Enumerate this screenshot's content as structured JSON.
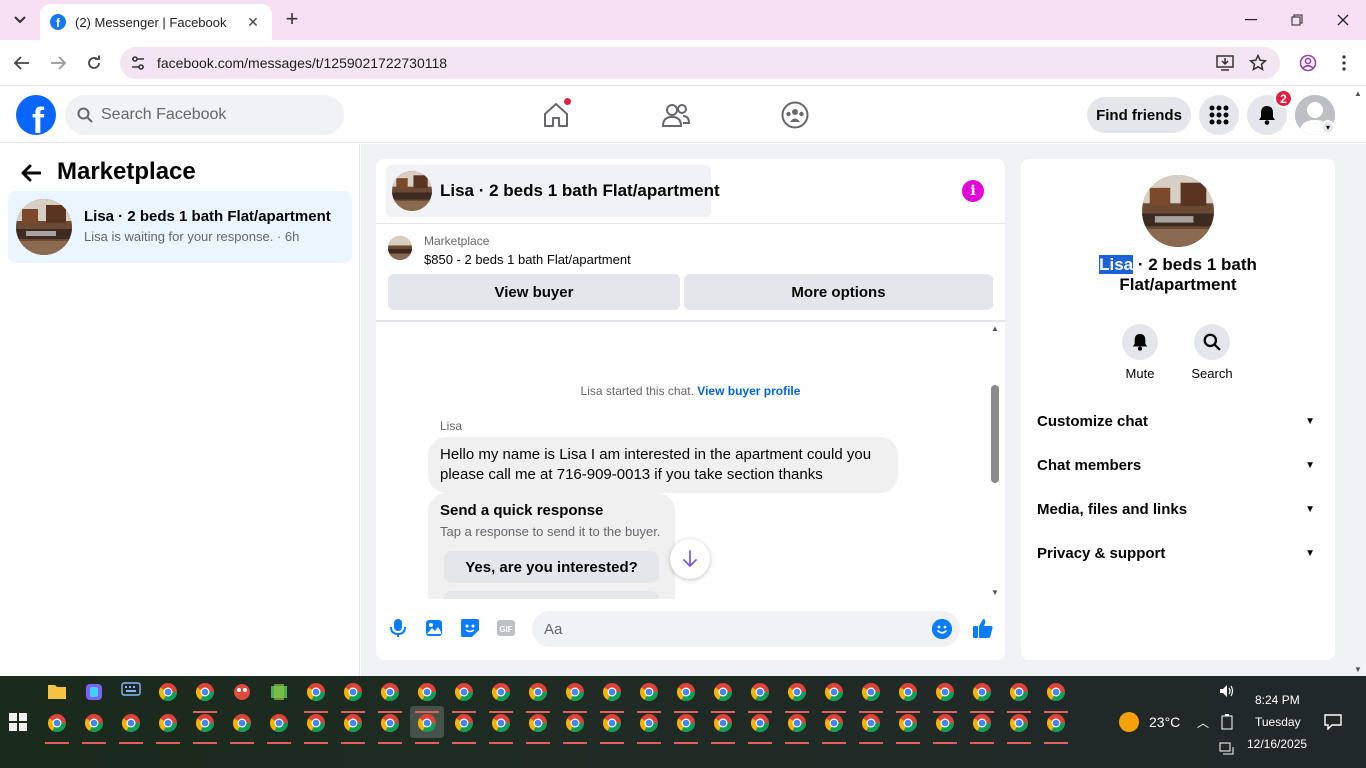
{
  "browser": {
    "tab_title": "(2) Messenger | Facebook",
    "url": "facebook.com/messages/t/1259021722730118"
  },
  "facebook": {
    "search_placeholder": "Search Facebook",
    "find_friends": "Find friends",
    "notification_count": "2"
  },
  "sidebar": {
    "title": "Marketplace",
    "conversations": [
      {
        "title": "Lisa · 2 beds 1 bath Flat/apartment",
        "subtitle": "Lisa is waiting for your response. · 6h"
      }
    ]
  },
  "chat": {
    "header_title": "Lisa · 2 beds 1 bath Flat/apartment",
    "listing_label": "Marketplace",
    "listing_price_title": "$850 - 2 beds 1 bath Flat/apartment",
    "view_buyer": "View buyer",
    "more_options": "More options",
    "started_text": "Lisa started this chat.",
    "view_buyer_profile": "View buyer profile",
    "sender_name": "Lisa",
    "message": "Hello my name is Lisa I am interested in the apartment could you please call me at 716-909-0013 if you take section thanks",
    "quick_title": "Send a quick response",
    "quick_subtitle": "Tap a response to send it to the buyer.",
    "quick_options": [
      "Yes, are you interested?"
    ],
    "input_placeholder": "Aa"
  },
  "info_panel": {
    "name_selected": "Lisa",
    "name_rest": " · 2 beds 1 bath Flat/apartment",
    "mute": "Mute",
    "search": "Search",
    "sections": [
      "Customize chat",
      "Chat members",
      "Media, files and links",
      "Privacy & support"
    ]
  },
  "taskbar": {
    "weather": "23°C",
    "time": "8:24 PM",
    "day": "Tuesday",
    "date": "12/16/2025"
  },
  "colors": {
    "fb_blue": "#0866ff",
    "messenger_purple": "#e008d7",
    "selected_conv": "#ebf5ff",
    "tab_strip": "#f6dff3"
  }
}
